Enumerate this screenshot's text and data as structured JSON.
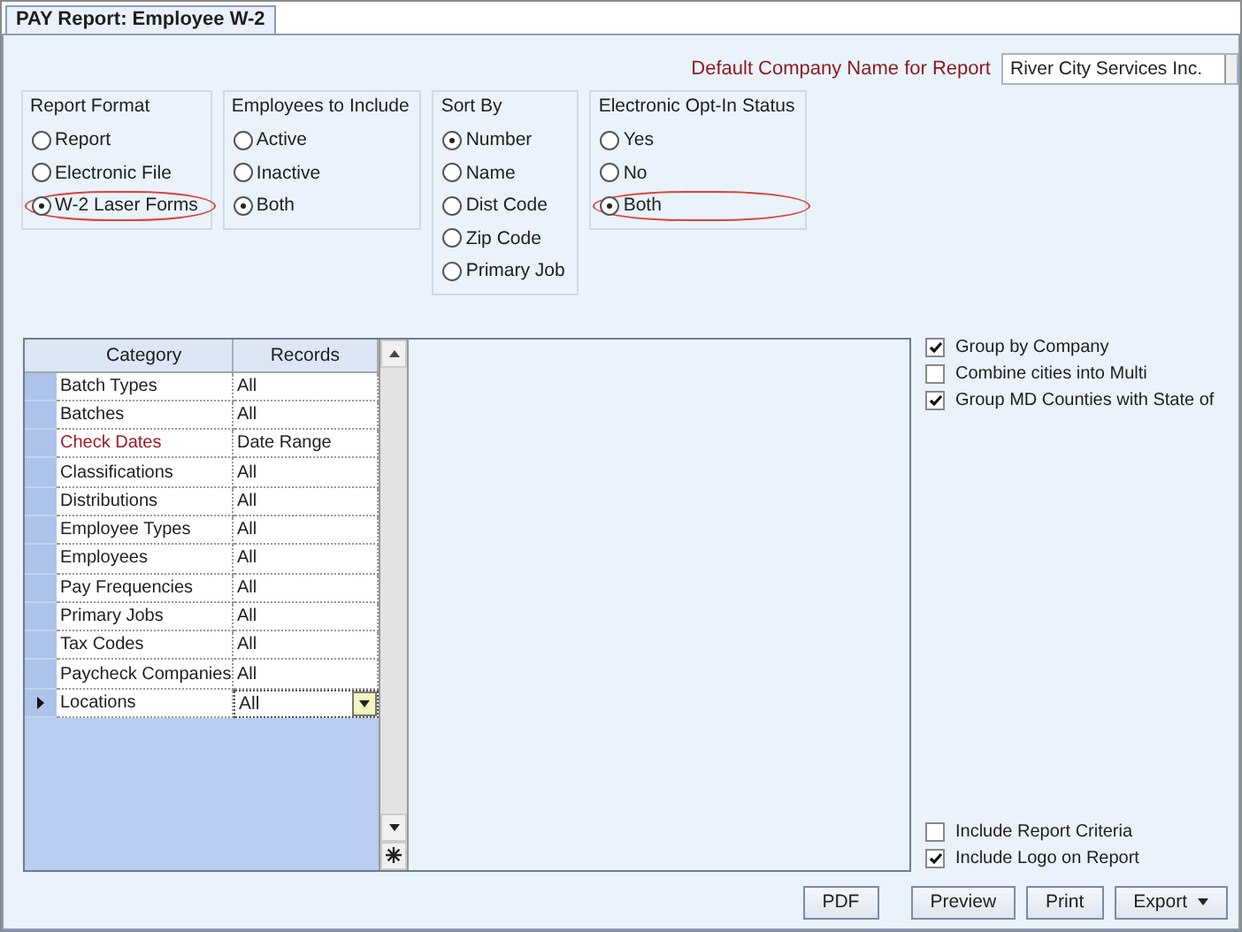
{
  "tab": {
    "label": "PAY Report: Employee W-2",
    "selected": true
  },
  "company": {
    "label": "Default Company Name for Report",
    "value": "River City Services Inc."
  },
  "groups": [
    {
      "title": "Report Format",
      "options": [
        {
          "label": "Report",
          "selected": false,
          "highlighted": false
        },
        {
          "label": "Electronic File",
          "selected": false,
          "highlighted": false
        },
        {
          "label": "W-2 Laser Forms",
          "selected": true,
          "highlighted": true
        }
      ]
    },
    {
      "title": "Employees to Include",
      "options": [
        {
          "label": "Active",
          "selected": false,
          "highlighted": false
        },
        {
          "label": "Inactive",
          "selected": false,
          "highlighted": false
        },
        {
          "label": "Both",
          "selected": true,
          "highlighted": false
        }
      ]
    },
    {
      "title": "Sort By",
      "options": [
        {
          "label": "Number",
          "selected": true,
          "highlighted": false
        },
        {
          "label": "Name",
          "selected": false,
          "highlighted": false
        },
        {
          "label": "Dist Code",
          "selected": false,
          "highlighted": false
        },
        {
          "label": "Zip Code",
          "selected": false,
          "highlighted": false
        },
        {
          "label": "Primary Job",
          "selected": false,
          "highlighted": false
        }
      ]
    },
    {
      "title": "Electronic Opt-In Status",
      "options": [
        {
          "label": "Yes",
          "selected": false,
          "highlighted": false
        },
        {
          "label": "No",
          "selected": false,
          "highlighted": false
        },
        {
          "label": "Both",
          "selected": true,
          "highlighted": true
        }
      ]
    }
  ],
  "grid": {
    "columns": [
      "Category",
      "Records"
    ],
    "rows": [
      {
        "category": "Batch Types",
        "records": "All",
        "flagged": false,
        "selected": false
      },
      {
        "category": "Batches",
        "records": "All",
        "flagged": false,
        "selected": false
      },
      {
        "category": "Check Dates",
        "records": "Date Range",
        "flagged": true,
        "selected": false
      },
      {
        "category": "Classifications",
        "records": "All",
        "flagged": false,
        "selected": false
      },
      {
        "category": "Distributions",
        "records": "All",
        "flagged": false,
        "selected": false
      },
      {
        "category": "Employee Types",
        "records": "All",
        "flagged": false,
        "selected": false
      },
      {
        "category": "Employees",
        "records": "All",
        "flagged": false,
        "selected": false
      },
      {
        "category": "Pay Frequencies",
        "records": "All",
        "flagged": false,
        "selected": false
      },
      {
        "category": "Primary Jobs",
        "records": "All",
        "flagged": false,
        "selected": false
      },
      {
        "category": "Tax Codes",
        "records": "All",
        "flagged": false,
        "selected": false
      },
      {
        "category": "Paycheck Companies",
        "records": "All",
        "flagged": false,
        "selected": false
      },
      {
        "category": "Locations",
        "records": "All",
        "flagged": false,
        "selected": true
      }
    ]
  },
  "options_top": [
    {
      "label": "Group by Company",
      "checked": true
    },
    {
      "label": "Combine cities into Multi",
      "checked": false
    },
    {
      "label": "Group MD Counties with State of",
      "checked": true
    }
  ],
  "options_bottom": [
    {
      "label": "Include Report Criteria",
      "checked": false
    },
    {
      "label": "Include Logo on Report",
      "checked": true
    }
  ],
  "buttons": [
    {
      "label": "PDF",
      "kind": "plain"
    },
    {
      "label": "Preview",
      "kind": "plain"
    },
    {
      "label": "Print",
      "kind": "plain"
    },
    {
      "label": "Export",
      "kind": "split"
    }
  ]
}
